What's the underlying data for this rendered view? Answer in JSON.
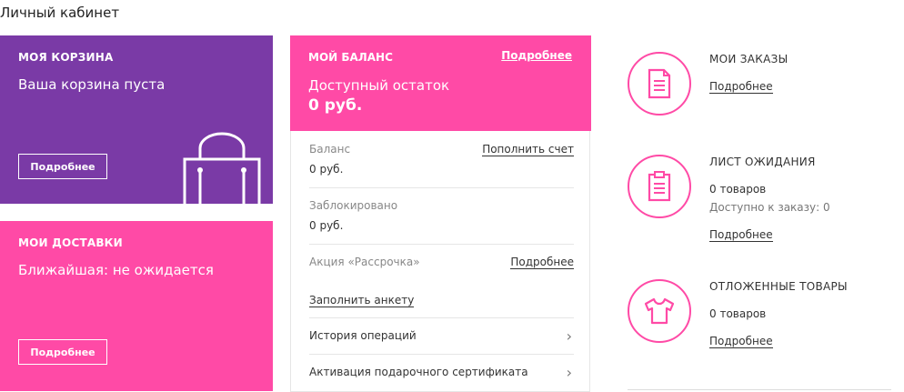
{
  "page": {
    "title": "Личный кабинет"
  },
  "cart": {
    "label": "МОЯ КОРЗИНА",
    "status": "Ваша корзина пуста",
    "button": "Подробнее"
  },
  "delivery": {
    "label": "МОИ ДОСТАВКИ",
    "status": "Ближайшая: не ожидается",
    "button": "Подробнее"
  },
  "balance": {
    "label": "МОЙ БАЛАНС",
    "more_link": "Подробнее",
    "available_label": "Доступный остаток",
    "available_amount": "0 руб.",
    "rows": [
      {
        "label": "Баланс",
        "value": "0 руб.",
        "action": "Пополнить счет"
      },
      {
        "label": "Заблокировано",
        "value": "0 руб."
      },
      {
        "label": "Акция «Рассрочка»",
        "action": "Подробнее",
        "link": "Заполнить анкету"
      }
    ],
    "nav": [
      {
        "label": "История операций"
      },
      {
        "label": "Активация подарочного сертификата"
      }
    ]
  },
  "info_blocks": {
    "orders": {
      "title": "МОИ ЗАКАЗЫ",
      "link": "Подробнее",
      "icon": "document-icon"
    },
    "waitlist": {
      "title": "ЛИСТ ОЖИДАНИЯ",
      "count": "0 товаров",
      "available": "Доступно к заказу: 0",
      "link": "Подробнее",
      "icon": "clipboard-icon"
    },
    "deferred": {
      "title": "ОТЛОЖЕННЫЕ ТОВАРЫ",
      "count": "0 товаров",
      "link": "Подробнее",
      "icon": "tshirt-icon"
    }
  },
  "colors": {
    "purple": "#7a3aa6",
    "pink": "#ff4aa6",
    "divider": "#e6e6e6"
  }
}
